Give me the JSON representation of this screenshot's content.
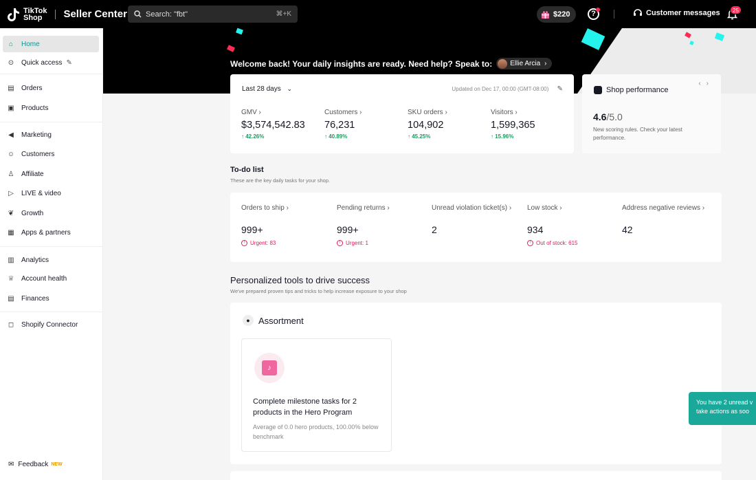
{
  "header": {
    "brand_top": "TikTok",
    "brand_bottom": "Shop",
    "app_title": "Seller Center",
    "search_text": "Search: \"fbt\"",
    "search_shortcut": "⌘+K",
    "reward_amount": "$220",
    "help_label": "?",
    "customer_messages": "Customer messages",
    "notification_count": "25"
  },
  "sidebar": {
    "items": [
      {
        "label": "Home",
        "icon": "home-icon"
      },
      {
        "label": "Quick access",
        "icon": "quick-access-icon"
      },
      {
        "label": "Orders",
        "icon": "orders-icon"
      },
      {
        "label": "Products",
        "icon": "products-icon"
      },
      {
        "label": "Marketing",
        "icon": "megaphone-icon"
      },
      {
        "label": "Customers",
        "icon": "customers-icon"
      },
      {
        "label": "Affiliate",
        "icon": "affiliate-icon"
      },
      {
        "label": "LIVE & video",
        "icon": "video-icon"
      },
      {
        "label": "Growth",
        "icon": "growth-icon"
      },
      {
        "label": "Apps & partners",
        "icon": "apps-icon"
      },
      {
        "label": "Analytics",
        "icon": "analytics-icon"
      },
      {
        "label": "Account health",
        "icon": "trophy-icon"
      },
      {
        "label": "Finances",
        "icon": "finances-icon"
      },
      {
        "label": "Shopify Connector",
        "icon": "shopify-icon"
      }
    ],
    "feedback": "Feedback",
    "feedback_badge": "NEW"
  },
  "welcome": {
    "text": "Welcome back! Your daily insights are ready. Need help? Speak to:",
    "contact": "Ellie Arcia"
  },
  "metrics": {
    "period": "Last 28 days",
    "updated": "Updated on Dec 17, 00:00 (GMT-08:00)",
    "items": [
      {
        "label": "GMV",
        "value": "$3,574,542.83",
        "change": "42.26%"
      },
      {
        "label": "Customers",
        "value": "76,231",
        "change": "40.89%"
      },
      {
        "label": "SKU orders",
        "value": "104,902",
        "change": "45.25%"
      },
      {
        "label": "Visitors",
        "value": "1,599,365",
        "change": "15.96%"
      }
    ]
  },
  "performance": {
    "title": "Shop performance",
    "score": "4.6",
    "score_max": "/5.0",
    "description": "New scoring rules. Check your latest performance."
  },
  "todo": {
    "title": "To-do list",
    "subtitle": "These are the key daily tasks for your shop.",
    "items": [
      {
        "label": "Orders to ship",
        "value": "999+",
        "note": "Urgent: 83"
      },
      {
        "label": "Pending returns",
        "value": "999+",
        "note": "Urgent: 1"
      },
      {
        "label": "Unread violation ticket(s)",
        "value": "2",
        "note": ""
      },
      {
        "label": "Low stock",
        "value": "934",
        "note": "Out of stock: 615"
      },
      {
        "label": "Address negative reviews",
        "value": "42",
        "note": ""
      }
    ]
  },
  "tools": {
    "title": "Personalized tools to drive success",
    "subtitle": "We've prepared proven tips and tricks to help increase exposure to your shop",
    "section": "Assortment",
    "card_title": "Complete milestone tasks for 2 products in the Hero Program",
    "card_desc": "Average of 0.0 hero products, 100.00% below benchmark"
  },
  "toast": {
    "line1": "You have 2 unread v",
    "line2": "take actions as soo"
  },
  "colors": {
    "accent": "#009995",
    "positive": "#1a9c5d",
    "urgent": "#e0195a",
    "toast": "#1aa89a"
  }
}
